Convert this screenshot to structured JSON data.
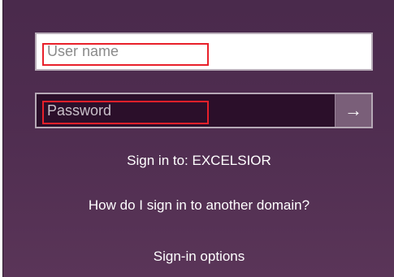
{
  "username": {
    "placeholder": "User name",
    "value": ""
  },
  "password": {
    "placeholder": "Password",
    "value": "",
    "submit_icon": "arrow-right-icon",
    "submit_glyph": "→"
  },
  "sign_in_to": "Sign in to: EXCELSIOR",
  "other_domain_link": "How do I sign in to another domain?",
  "sign_in_options_link": "Sign-in options",
  "colors": {
    "background": "#4f2d50",
    "password_field": "#2b0f2a",
    "submit_button": "#7a5f79",
    "highlight": "#e8202a"
  }
}
